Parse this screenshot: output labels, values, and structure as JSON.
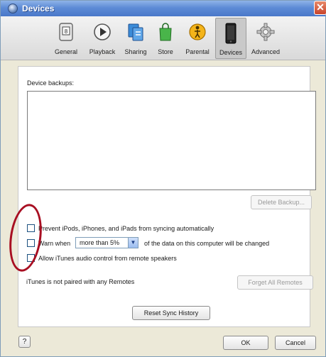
{
  "window": {
    "title": "Devices"
  },
  "toolbar": {
    "items": [
      {
        "label": "General",
        "icon": "general-icon"
      },
      {
        "label": "Playback",
        "icon": "playback-icon"
      },
      {
        "label": "Sharing",
        "icon": "sharing-icon"
      },
      {
        "label": "Store",
        "icon": "store-icon"
      },
      {
        "label": "Parental",
        "icon": "parental-icon"
      },
      {
        "label": "Devices",
        "icon": "devices-icon",
        "selected": true
      },
      {
        "label": "Advanced",
        "icon": "advanced-icon"
      }
    ]
  },
  "backups": {
    "label": "Device backups:",
    "items": [],
    "delete_button": "Delete Backup..."
  },
  "options": {
    "prevent_sync": {
      "label": "Prevent iPods, iPhones, and iPads from syncing automatically",
      "checked": false
    },
    "warn": {
      "prefix": "Warn when",
      "selected": "more than 5%",
      "suffix": "of the data on this computer will be changed",
      "checked": false
    },
    "remote_audio": {
      "label": "Allow iTunes audio control from remote speakers",
      "checked": false
    }
  },
  "remotes": {
    "status": "iTunes is not paired with any Remotes",
    "forget_button": "Forget All Remotes"
  },
  "reset_button": "Reset Sync History",
  "footer": {
    "help": "?",
    "ok": "OK",
    "cancel": "Cancel"
  },
  "colors": {
    "annotation": "#a80f22",
    "titlebar": "#5d8bd6"
  }
}
